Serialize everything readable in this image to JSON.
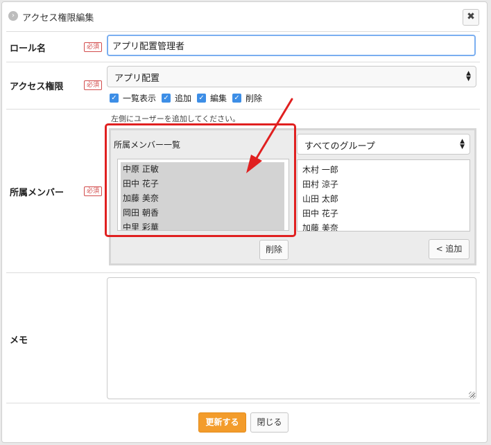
{
  "dialog": {
    "title": "アクセス権限編集",
    "close_label": "✖"
  },
  "role": {
    "label": "ロール名",
    "required": "必須",
    "value": "アプリ配置管理者"
  },
  "access": {
    "label": "アクセス権限",
    "required": "必須",
    "selected": "アプリ配置",
    "permissions": [
      {
        "label": "一覧表示",
        "checked": true
      },
      {
        "label": "追加",
        "checked": true
      },
      {
        "label": "編集",
        "checked": true
      },
      {
        "label": "削除",
        "checked": true
      }
    ]
  },
  "members": {
    "label": "所属メンバー",
    "required": "必須",
    "hint": "左側にユーザーを追加してください。",
    "panel_title": "所属メンバー一覧",
    "current": [
      "中原 正敏",
      "田中 花子",
      "加藤 美奈",
      "岡田 朝香",
      "中里 彩華"
    ],
    "group_filter": "すべてのグループ",
    "available": [
      "木村 一郎",
      "田村 涼子",
      "山田 太郎",
      "田中 花子",
      "加藤 美奈"
    ],
    "remove_label": "削除",
    "add_label": "< 追加"
  },
  "memo": {
    "label": "メモ",
    "value": ""
  },
  "footer": {
    "update_label": "更新する",
    "close_label": "閉じる"
  },
  "colors": {
    "accent": "#f39c2b",
    "highlight": "#e02020",
    "checkbox": "#3d8ee6",
    "required": "#d24b4b"
  }
}
